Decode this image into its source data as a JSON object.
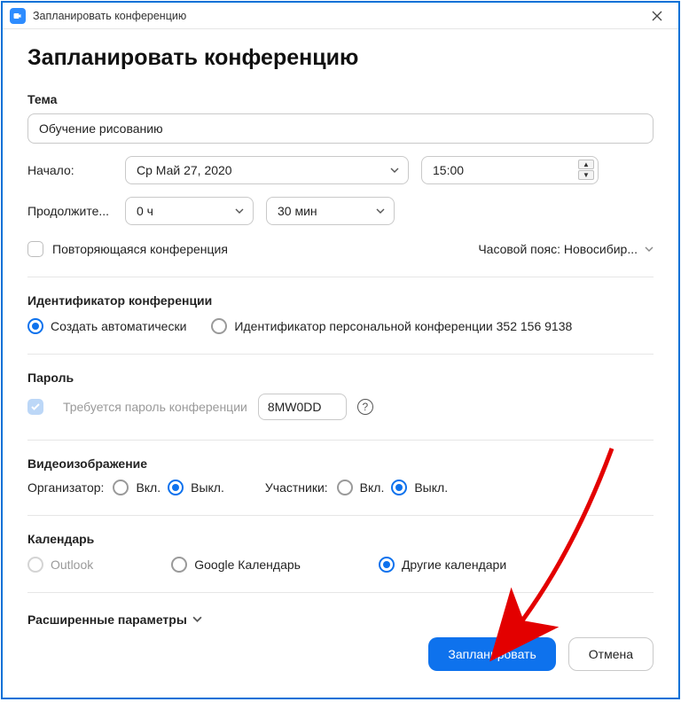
{
  "window": {
    "title": "Запланировать конференцию"
  },
  "heading": "Запланировать конференцию",
  "topic": {
    "label": "Тема",
    "value": "Обучение рисованию"
  },
  "start": {
    "label": "Начало:",
    "date": "Ср  Май 27, 2020",
    "time": "15:00"
  },
  "duration": {
    "label": "Продолжите...",
    "hours": "0 ч",
    "minutes": "30 мин"
  },
  "recurring": {
    "label": "Повторяющаяся конференция",
    "checked": false
  },
  "timezone": {
    "text": "Часовой пояс: Новосибир..."
  },
  "meeting_id": {
    "section": "Идентификатор конференции",
    "auto": "Создать автоматически",
    "personal": "Идентификатор персональной конференции 352 156 9138",
    "selected": "auto"
  },
  "password": {
    "section": "Пароль",
    "require_label": "Требуется пароль конференции",
    "value": "8MW0DD"
  },
  "video": {
    "section": "Видеоизображение",
    "host_label": "Организатор:",
    "part_label": "Участники:",
    "on": "Вкл.",
    "off": "Выкл."
  },
  "calendar": {
    "section": "Календарь",
    "outlook": "Outlook",
    "google": "Google Календарь",
    "other": "Другие календари",
    "selected": "other"
  },
  "advanced": {
    "label": "Расширенные параметры"
  },
  "buttons": {
    "schedule": "Запланировать",
    "cancel": "Отмена"
  }
}
